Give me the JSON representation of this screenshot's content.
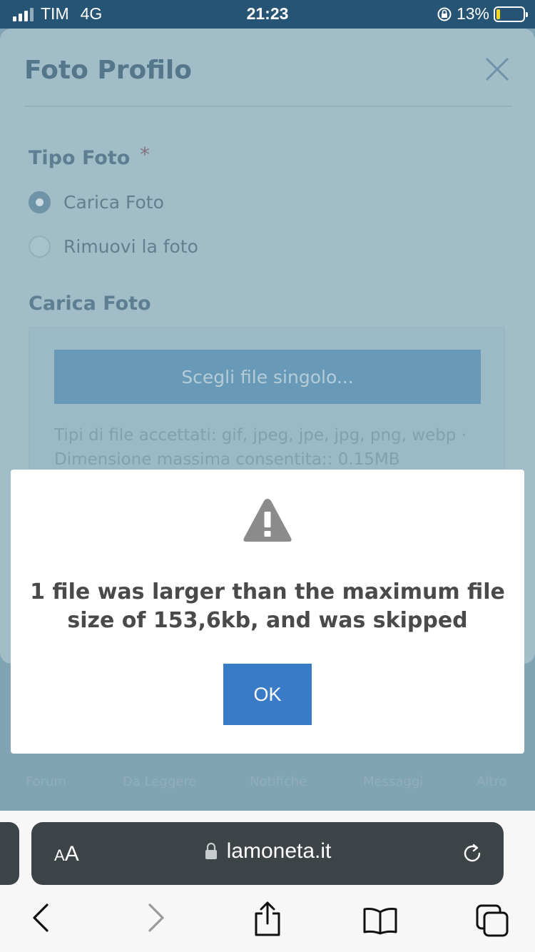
{
  "status_bar": {
    "carrier": "TIM",
    "network": "4G",
    "time": "21:23",
    "battery": "13%",
    "battery_level": 0.13
  },
  "sheet": {
    "title": "Foto Profilo",
    "photo_type_label": "Tipo Foto",
    "required_marker": "*",
    "options": [
      {
        "label": "Carica Foto",
        "checked": true
      },
      {
        "label": "Rimuovi la foto",
        "checked": false
      }
    ],
    "upload_label": "Carica Foto",
    "choose_button": "Scegli file singolo...",
    "accepted_types": "Tipi di file accettati: gif, jpeg, jpe, jpg, png, webp ·",
    "max_size": "Dimensione massima consentita:: 0.15MB"
  },
  "bottom_nav": [
    "Forum",
    "Da Leggere",
    "Notifiche",
    "Messaggi",
    "Altro"
  ],
  "dialog": {
    "message": "1 file was larger than the maximum file size of 153,6kb, and was skipped",
    "ok": "OK",
    "icon": "warning-icon"
  },
  "browser": {
    "aa_small": "A",
    "aa_big": "A",
    "url": "lamoneta.it"
  },
  "colors": {
    "ok_button": "#3a7bc8",
    "status_bar": "#255474",
    "battery_fill": "#f7d51e"
  }
}
